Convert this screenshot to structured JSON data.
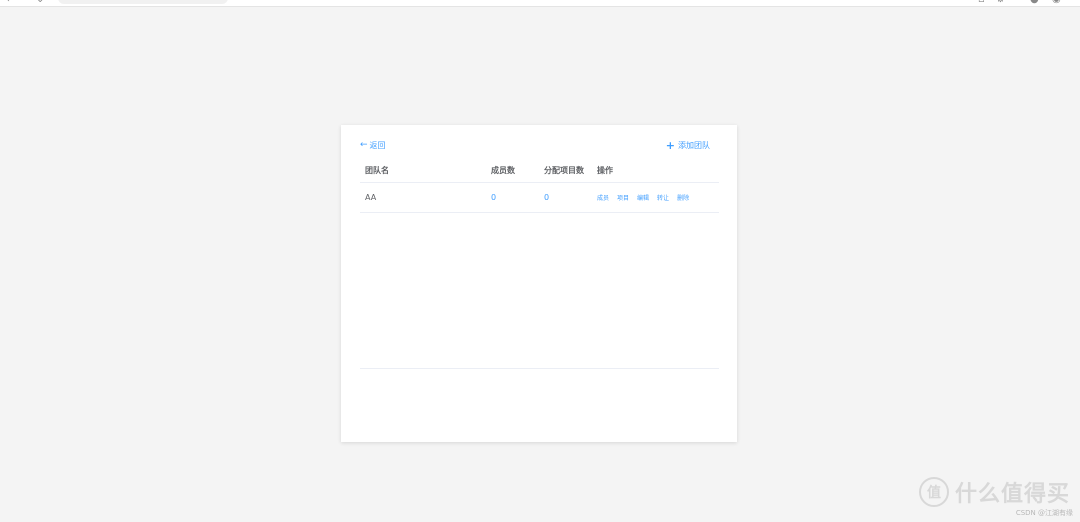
{
  "card": {
    "back_label": "返回",
    "add_label": "添加团队"
  },
  "table": {
    "headers": [
      "团队名",
      "成员数",
      "分配项目数",
      "操作"
    ],
    "rows": [
      {
        "name": "AA",
        "members": "0",
        "projects": "0",
        "actions": [
          "成员",
          "项目",
          "编辑",
          "转让",
          "删除"
        ]
      }
    ]
  },
  "watermark": {
    "badge": "值",
    "text": "什么值得买",
    "credit": "CSDN @江湖有缘"
  },
  "colors": {
    "accent": "#409eff",
    "text": "#606266",
    "background": "#f4f4f4"
  },
  "icons": {
    "back": "arrow-left-icon",
    "add": "plus-icon"
  }
}
